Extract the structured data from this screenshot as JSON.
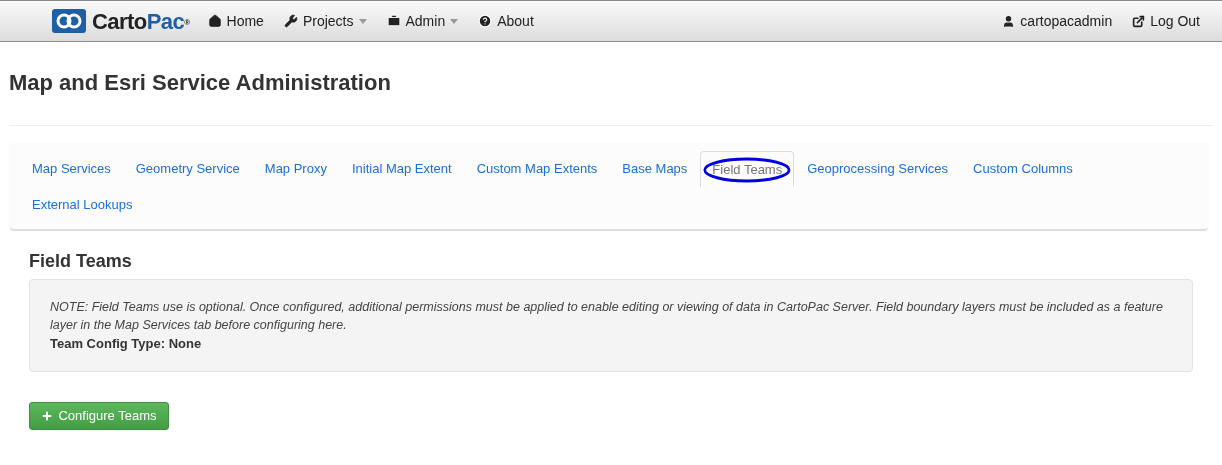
{
  "navbar": {
    "logo": {
      "name": "Carto",
      "accent": "Pac",
      "mark": "®"
    },
    "items": [
      {
        "label": "Home",
        "dropdown": false
      },
      {
        "label": "Projects",
        "dropdown": true
      },
      {
        "label": "Admin",
        "dropdown": true
      },
      {
        "label": "About",
        "dropdown": false
      }
    ],
    "right_items": [
      {
        "label": "cartopacadmin"
      },
      {
        "label": "Log Out"
      }
    ]
  },
  "page_title": "Map and Esri Service Administration",
  "tabs": [
    {
      "label": "Map Services",
      "selected": false,
      "highlighted": false
    },
    {
      "label": "Geometry Service",
      "selected": false,
      "highlighted": false
    },
    {
      "label": "Map Proxy",
      "selected": false,
      "highlighted": false
    },
    {
      "label": "Initial Map Extent",
      "selected": false,
      "highlighted": false
    },
    {
      "label": "Custom Map Extents",
      "selected": false,
      "highlighted": false
    },
    {
      "label": "Base Maps",
      "selected": false,
      "highlighted": false
    },
    {
      "label": "Field Teams",
      "selected": true,
      "highlighted": true
    },
    {
      "label": "Geoprocessing Services",
      "selected": false,
      "highlighted": false
    },
    {
      "label": "Custom Columns",
      "selected": false,
      "highlighted": false
    },
    {
      "label": "External Lookups",
      "selected": false,
      "highlighted": false
    }
  ],
  "section": {
    "title": "Field Teams",
    "note": "NOTE: Field Teams use is optional. Once configured, additional permissions must be applied to enable editing or viewing of data in CartoPac Server. Field boundary layers must be included as a feature layer in the Map Services tab before configuring here.",
    "config_type": "Team Config Type: None",
    "button": "Configure Teams"
  }
}
